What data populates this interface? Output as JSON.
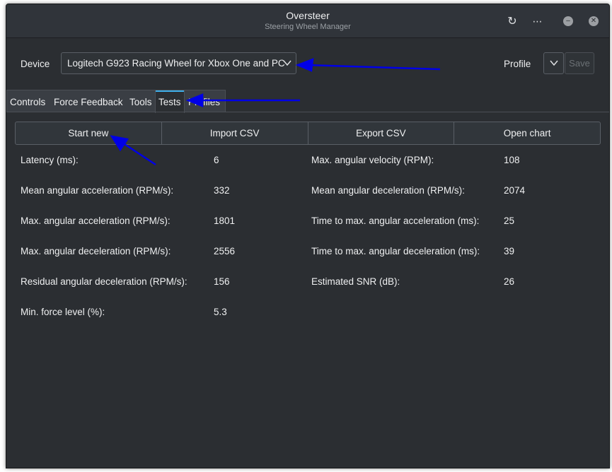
{
  "window": {
    "title": "Oversteer",
    "subtitle": "Steering Wheel Manager"
  },
  "titlebar_icons": {
    "refresh": "↻",
    "menu": "⋯",
    "minimize": "–",
    "close": "✕"
  },
  "device": {
    "label": "Device",
    "selected": "Logitech G923 Racing Wheel for Xbox One and PC"
  },
  "profile": {
    "label": "Profile",
    "save_label": "Save"
  },
  "tabs": [
    {
      "label": "Controls",
      "active": false
    },
    {
      "label": "Force Feedback",
      "active": false
    },
    {
      "label": "Tools",
      "active": false
    },
    {
      "label": "Tests",
      "active": true
    },
    {
      "label": "Profiles",
      "active": false
    }
  ],
  "actions": [
    "Start new",
    "Import CSV",
    "Export CSV",
    "Open chart"
  ],
  "stats_left": [
    {
      "label": "Latency (ms):",
      "value": "6"
    },
    {
      "label": "Mean angular acceleration (RPM/s):",
      "value": "332"
    },
    {
      "label": "Max. angular acceleration (RPM/s):",
      "value": "1801"
    },
    {
      "label": "Max. angular deceleration (RPM/s):",
      "value": "2556"
    },
    {
      "label": "Residual angular deceleration (RPM/s):",
      "value": "156"
    },
    {
      "label": "Min. force level (%):",
      "value": "5.3"
    }
  ],
  "stats_right": [
    {
      "label": "Max. angular velocity (RPM):",
      "value": "108"
    },
    {
      "label": "Mean angular deceleration (RPM/s):",
      "value": "2074"
    },
    {
      "label": "Time to max. angular acceleration (ms):",
      "value": "25"
    },
    {
      "label": "Time to max. angular deceleration (ms):",
      "value": "39"
    },
    {
      "label": "Estimated SNR (dB):",
      "value": "26"
    }
  ],
  "colors": {
    "accent": "#3daee9",
    "annotation_arrow": "#0000e6",
    "background": "#2b2e32"
  }
}
